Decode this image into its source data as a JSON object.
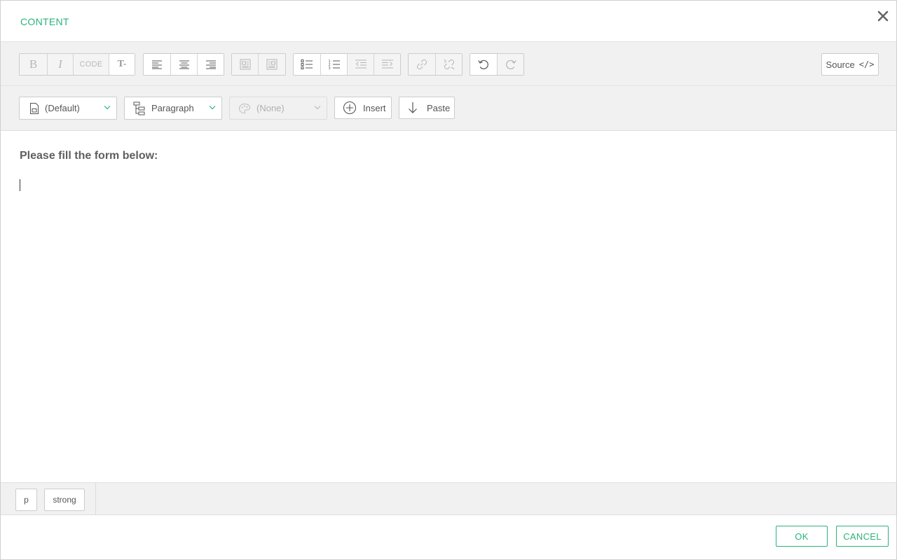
{
  "dialog": {
    "title": "CONTENT",
    "close_icon": "close-icon"
  },
  "toolbar": {
    "bold": "B",
    "italic": "I",
    "code": "CODE",
    "clear_format": "T-",
    "source_label": "Source",
    "source_symbol": "</>"
  },
  "formatbar": {
    "style_value": "(Default)",
    "block_value": "Paragraph",
    "class_value": "(None)",
    "insert_label": "Insert",
    "paste_label": "Paste"
  },
  "editor": {
    "heading_text": "Please fill the form below:"
  },
  "pathbar": {
    "crumbs": [
      "p",
      "strong"
    ]
  },
  "footer": {
    "ok_label": "OK",
    "cancel_label": "CANCEL"
  },
  "colors": {
    "accent": "#2bb37a",
    "toolbar_bg": "#f1f1f1",
    "border": "#cccccc"
  }
}
